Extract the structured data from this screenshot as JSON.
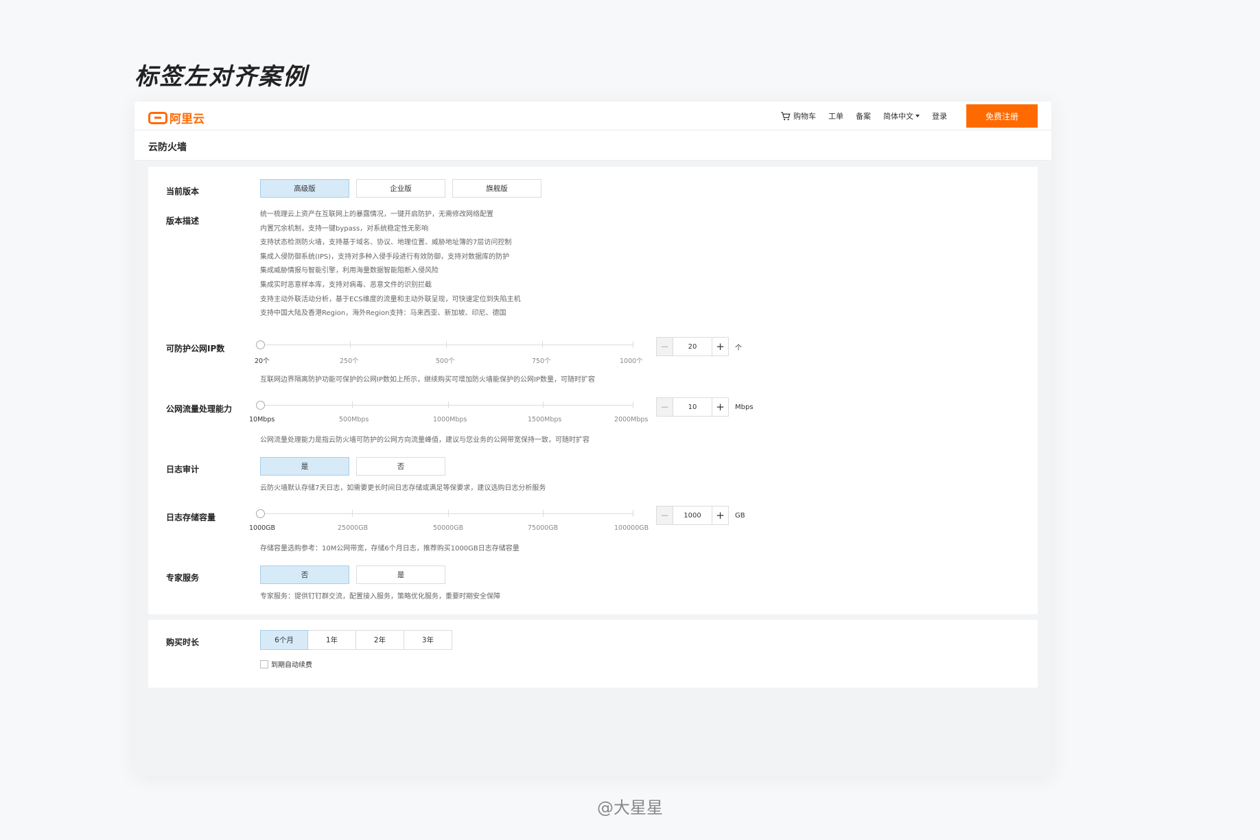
{
  "page": {
    "heading": "标签左对齐案例",
    "watermark": "@大星星"
  },
  "topnav": {
    "logo_text": "阿里云",
    "items": {
      "cart": "购物车",
      "ticket": "工单",
      "filing": "备案",
      "language": "简体中文",
      "login": "登录"
    },
    "register_label": "免费注册",
    "accent_color": "#ff6a00"
  },
  "product": {
    "title": "云防火墙"
  },
  "form": {
    "version": {
      "label": "当前版本",
      "options": [
        "高级版",
        "企业版",
        "旗舰版"
      ],
      "selected": "高级版"
    },
    "description": {
      "label": "版本描述",
      "lines": [
        "统一梳理云上资产在互联网上的暴露情况，一键开启防护，无需修改网络配置",
        "内置冗余机制，支持一键bypass，对系统稳定性无影响",
        "支持状态检测防火墙，支持基于域名、协议、地理位置、威胁地址簿的7层访问控制",
        "集成入侵防御系统(IPS)，支持对多种入侵手段进行有效防御，支持对数据库的防护",
        "集成威胁情报与智能引擎，利用海量数据智能阻断入侵风险",
        "集成实时恶意样本库，支持对病毒、恶意文件的识别拦截",
        "支持主动外联活动分析，基于ECS维度的流量和主动外联呈现，可快速定位到失陷主机",
        "支持中国大陆及香港Region，海外Region支持：马来西亚、新加坡、印尼、德国"
      ]
    },
    "public_ip": {
      "label": "可防护公网IP数",
      "ticks": [
        "20个",
        "250个",
        "500个",
        "750个",
        "1000个"
      ],
      "value": "20",
      "unit": "个",
      "hint": "互联网边界隔离防护功能可保护的公网IP数如上所示，继续购买可增加防火墙能保护的公网IP数量，可随时扩容"
    },
    "bandwidth": {
      "label": "公网流量处理能力",
      "ticks": [
        "10Mbps",
        "500Mbps",
        "1000Mbps",
        "1500Mbps",
        "2000Mbps"
      ],
      "value": "10",
      "unit": "Mbps",
      "hint": "公网流量处理能力是指云防火墙可防护的公网方向流量峰值，建议与您业务的公网带宽保持一致，可随时扩容"
    },
    "log_audit": {
      "label": "日志审计",
      "options": [
        "是",
        "否"
      ],
      "selected": "是",
      "hint": "云防火墙默认存储7天日志，如需要更长时间日志存储或满足等保要求，建议选购日志分析服务"
    },
    "log_storage": {
      "label": "日志存储容量",
      "ticks": [
        "1000GB",
        "25000GB",
        "50000GB",
        "75000GB",
        "100000GB"
      ],
      "value": "1000",
      "unit": "GB",
      "hint": "存储容量选购参考：10M公网带宽，存储6个月日志，推荐购买1000GB日志存储容量"
    },
    "expert": {
      "label": "专家服务",
      "options": [
        "否",
        "是"
      ],
      "selected": "否",
      "hint": "专家服务：提供钉钉群交流，配置接入服务，策略优化服务，重要时期安全保障"
    }
  },
  "purchase": {
    "label": "购买时长",
    "durations": [
      "6个月",
      "1年",
      "2年",
      "3年"
    ],
    "selected": "6个月",
    "auto_renew_label": "到期自动续费",
    "auto_renew_checked": false
  },
  "icons": {
    "cart": "cart-icon",
    "dropdown": "chevron-down-icon",
    "minus": "minus-icon",
    "plus": "plus-icon"
  }
}
